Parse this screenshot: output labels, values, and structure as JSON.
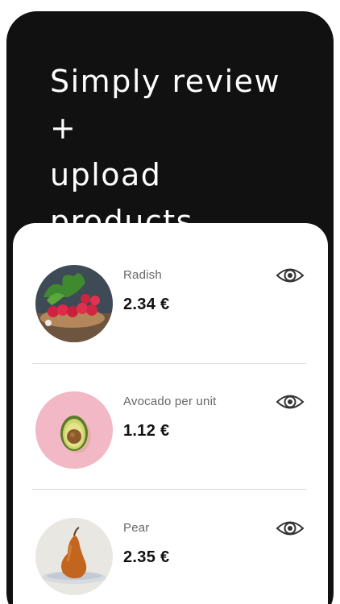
{
  "header": {
    "line1": "Simply review +",
    "line2": "upload products."
  },
  "products": [
    {
      "name": "Radish",
      "price": "2.34 €",
      "icon": "radish-image"
    },
    {
      "name": "Avocado per unit",
      "price": "1.12 €",
      "icon": "avocado-image"
    },
    {
      "name": "Pear",
      "price": "2.35 €",
      "icon": "pear-image"
    }
  ],
  "colors": {
    "background": "#111111",
    "card": "#ffffff",
    "text": "#111111",
    "muted": "#666666",
    "avocado_bg": "#f2b8c6"
  }
}
